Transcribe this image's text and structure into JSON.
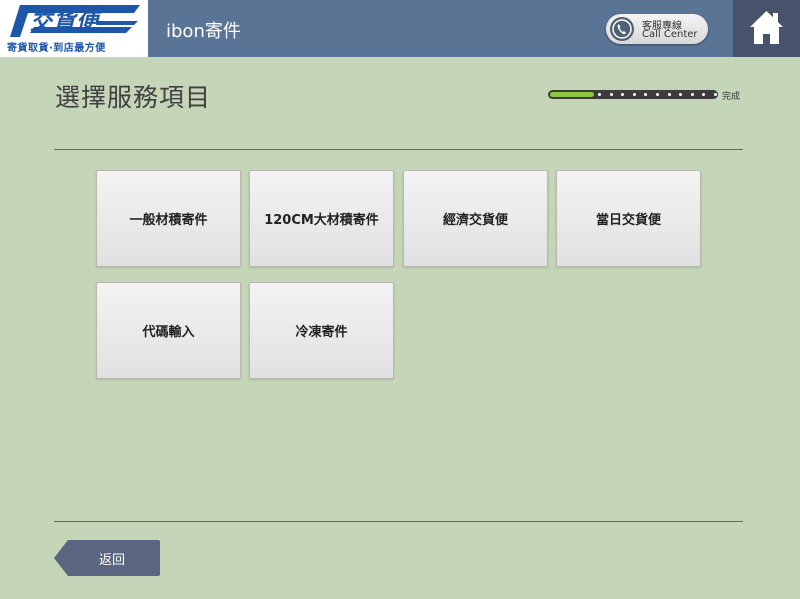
{
  "header": {
    "logo_text": "交貨便",
    "logo_tagline": "寄貨取貨·到店最方便",
    "app_title": "ibon寄件",
    "call_center": {
      "line1": "客服專線",
      "line2": "Call Center",
      "icon": "phone-icon"
    },
    "home_icon": "home-icon"
  },
  "page": {
    "title": "選擇服務項目",
    "progress": {
      "current_step": 1,
      "total_steps": 12,
      "end_label": "完成"
    }
  },
  "services": [
    {
      "label": "一般材積寄件"
    },
    {
      "label": "120CM大材積寄件"
    },
    {
      "label": "經濟交貨便"
    },
    {
      "label": "當日交貨便"
    },
    {
      "label": "代碼輸入"
    },
    {
      "label": "冷凍寄件"
    }
  ],
  "footer": {
    "back_label": "返回"
  },
  "colors": {
    "background": "#c5d5b8",
    "header": "#5a7495",
    "home": "#46536a",
    "progress_fill": "#8cc63f",
    "brand_blue": "#1e56a8"
  }
}
